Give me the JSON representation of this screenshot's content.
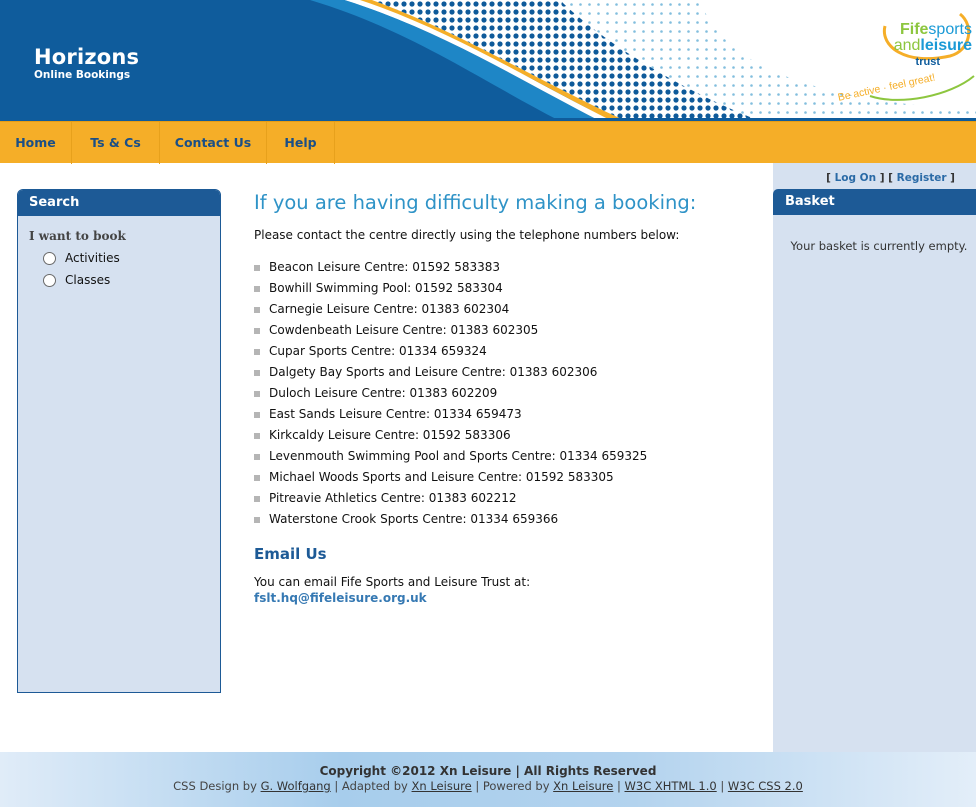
{
  "header": {
    "brand_title": "Horizons",
    "brand_subtitle": "Online Bookings",
    "logo": {
      "line1_a": "Fife",
      "line1_b": "sports",
      "line2_a": "and",
      "line2_b": "leisure",
      "line3": "trust",
      "tagline": "Be active · feel great!"
    }
  },
  "nav": {
    "items": [
      {
        "label": "Home"
      },
      {
        "label": "Ts & Cs"
      },
      {
        "label": "Contact Us"
      },
      {
        "label": "Help"
      }
    ]
  },
  "search": {
    "title": "Search",
    "want_label": "I want to book",
    "options": [
      {
        "label": "Activities",
        "checked": false
      },
      {
        "label": "Classes",
        "checked": false
      }
    ]
  },
  "main": {
    "title": "If you are having difficulty making a booking:",
    "intro": "Please contact the centre directly using the telephone numbers below:",
    "centres": [
      "Beacon Leisure Centre: 01592 583383",
      "Bowhill Swimming Pool: 01592 583304",
      "Carnegie Leisure Centre: 01383 602304",
      "Cowdenbeath Leisure Centre: 01383 602305",
      "Cupar Sports Centre: 01334 659324",
      "Dalgety Bay Sports and Leisure Centre: 01383 602306",
      "Duloch Leisure Centre: 01383 602209",
      "East Sands Leisure Centre: 01334 659473",
      "Kirkcaldy Leisure Centre: 01592 583306",
      "Levenmouth Swimming Pool and Sports Centre: 01334 659325",
      "Michael Woods Sports and Leisure Centre: 01592 583305",
      "Pitreavie Athletics Centre: 01383 602212",
      "Waterstone Crook Sports Centre: 01334 659366"
    ],
    "email_heading": "Email Us",
    "email_text": "You can email Fife Sports and Leisure Trust at:",
    "email_address": "fslt.hq@fifeleisure.org.uk"
  },
  "account": {
    "open_bracket": "[ ",
    "log_on": "Log On",
    "middle": " ] [ ",
    "register": "Register",
    "close_bracket": " ]"
  },
  "basket": {
    "title": "Basket",
    "empty_text": "Your basket is currently empty."
  },
  "footer": {
    "copyright": "Copyright ©2012 Xn Leisure | All Rights Reserved",
    "css_design_by": "CSS Design by ",
    "designer": "G. Wolfgang",
    "adapted_by": " | Adapted by ",
    "adapter": "Xn Leisure",
    "powered_by": " | Powered by ",
    "powerer": "Xn Leisure",
    "sep": " | ",
    "xhtml": "W3C XHTML 1.0",
    "css": "W3C CSS 2.0"
  },
  "colors": {
    "header_blue": "#0f5c9c",
    "nav_orange": "#f5ae28",
    "nav_text": "#1a4f87",
    "panel_bg": "#d6e1f0",
    "panel_head": "#1d5a96",
    "title_blue": "#2f93c7",
    "logo_green": "#8dc63f",
    "logo_blue": "#1b9ad6"
  }
}
